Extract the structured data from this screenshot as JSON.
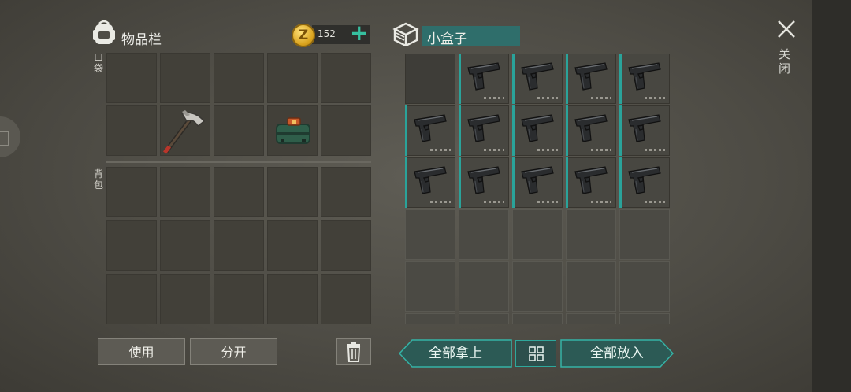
{
  "inventory": {
    "title": "物品栏",
    "pocket_label": "口袋",
    "backpack_label": "背包",
    "coin_symbol": "Z",
    "coin_count": "152",
    "add_coins_label": "+",
    "items": [
      {
        "slot": 6,
        "icon": "pickaxe-icon"
      },
      {
        "slot": 8,
        "icon": "tool-case-icon"
      }
    ]
  },
  "container": {
    "title": "小盒子",
    "item_icon": "pistol-icon",
    "filled_count": 14
  },
  "actions": {
    "use_label": "使用",
    "split_label": "分开",
    "take_all_label": "全部拿上",
    "put_all_label": "全部放入",
    "close_label": "关闭"
  },
  "colors": {
    "accent": "#2aa39a",
    "coin": "#e0a820",
    "title_bar": "#2f6e6b"
  }
}
